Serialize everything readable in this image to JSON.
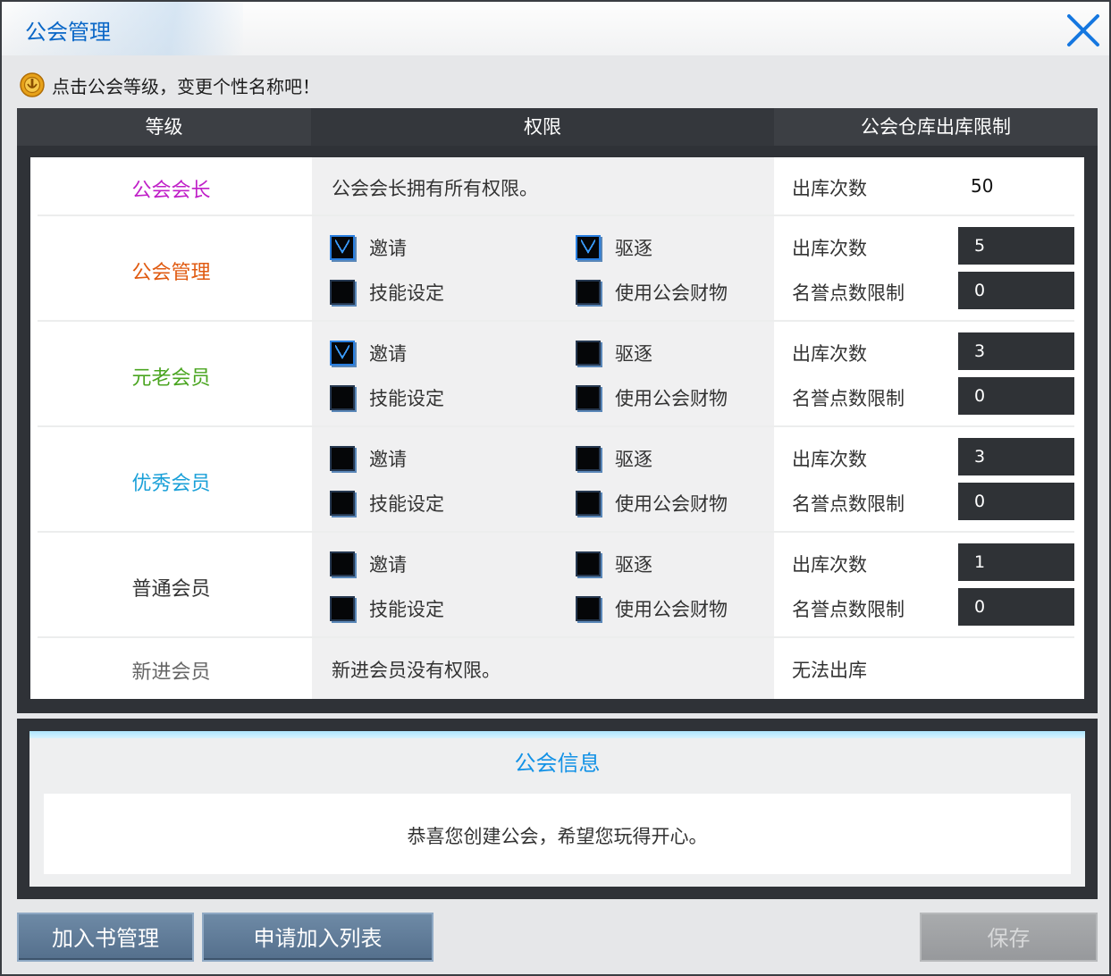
{
  "window": {
    "title": "公会管理"
  },
  "hint": {
    "text": "点击公会等级，变更个性名称吧！"
  },
  "table": {
    "headers": {
      "grade": "等级",
      "perms": "权限",
      "limit": "公会仓库出库限制"
    },
    "leader": {
      "name": "公会会长",
      "color": "#c020c8",
      "desc": "公会会长拥有所有权限。",
      "limit_label": "出库次数",
      "limit_value": "50"
    },
    "rows": [
      {
        "name": "公会管理",
        "color": "#e05a10",
        "perms": [
          {
            "label": "邀请",
            "checked": true
          },
          {
            "label": "驱逐",
            "checked": true
          },
          {
            "label": "技能设定",
            "checked": false
          },
          {
            "label": "使用公会财物",
            "checked": false
          }
        ],
        "count_label": "出库次数",
        "count": "5",
        "honor_label": "名誉点数限制",
        "honor": "0"
      },
      {
        "name": "元老会员",
        "color": "#4aa520",
        "perms": [
          {
            "label": "邀请",
            "checked": true
          },
          {
            "label": "驱逐",
            "checked": false
          },
          {
            "label": "技能设定",
            "checked": false
          },
          {
            "label": "使用公会财物",
            "checked": false
          }
        ],
        "count_label": "出库次数",
        "count": "3",
        "honor_label": "名誉点数限制",
        "honor": "0"
      },
      {
        "name": "优秀会员",
        "color": "#1aa0d8",
        "perms": [
          {
            "label": "邀请",
            "checked": false
          },
          {
            "label": "驱逐",
            "checked": false
          },
          {
            "label": "技能设定",
            "checked": false
          },
          {
            "label": "使用公会财物",
            "checked": false
          }
        ],
        "count_label": "出库次数",
        "count": "3",
        "honor_label": "名誉点数限制",
        "honor": "0"
      },
      {
        "name": "普通会员",
        "color": "#333333",
        "perms": [
          {
            "label": "邀请",
            "checked": false
          },
          {
            "label": "驱逐",
            "checked": false
          },
          {
            "label": "技能设定",
            "checked": false
          },
          {
            "label": "使用公会财物",
            "checked": false
          }
        ],
        "count_label": "出库次数",
        "count": "1",
        "honor_label": "名誉点数限制",
        "honor": "0"
      }
    ],
    "newbie": {
      "name": "新进会员",
      "color": "#666666",
      "desc": "新进会员没有权限。",
      "limit_text": "无法出库"
    }
  },
  "info": {
    "title": "公会信息",
    "message": "恭喜您创建公会，希望您玩得开心。"
  },
  "buttons": {
    "book_manage": "加入书管理",
    "apply_list": "申请加入列表",
    "save": "保存"
  },
  "icons": {
    "close": "close-x-icon",
    "hint": "guild-badge-icon"
  }
}
